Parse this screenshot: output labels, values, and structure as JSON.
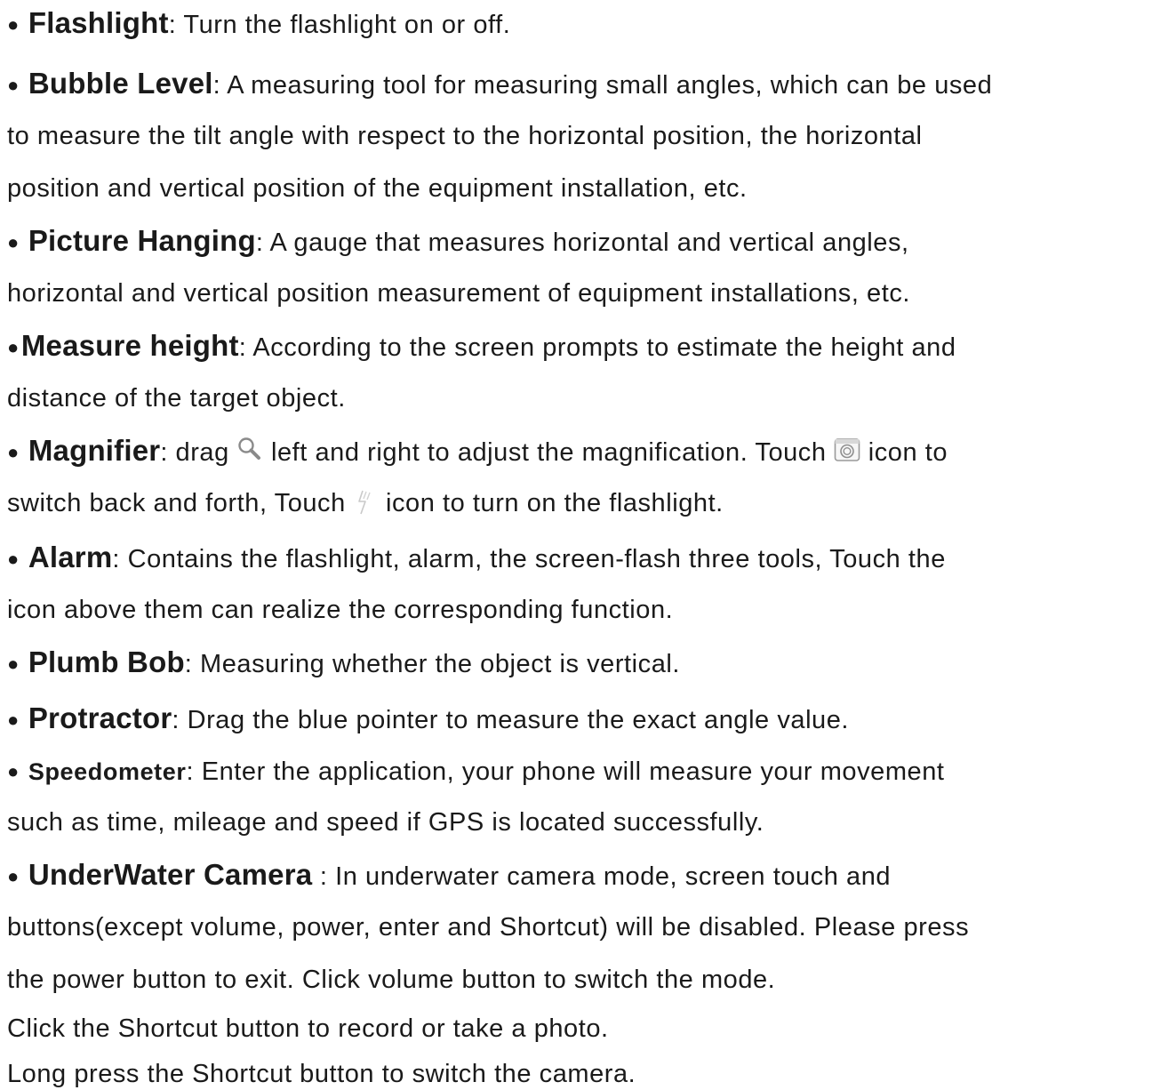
{
  "items": [
    {
      "term": "Flashlight",
      "sep": ": ",
      "text": "Turn the flashlight on or off."
    },
    {
      "term": "Bubble Level",
      "sep": ": ",
      "text": "A measuring tool for measuring small angles, which can be used",
      "cont": [
        "to measure the tilt angle with respect to the horizontal position, the horizontal",
        "position and vertical position of the equipment installation, etc."
      ]
    },
    {
      "term": "Picture Hanging",
      "sep": ": ",
      "text": "A gauge that measures horizontal and vertical angles,",
      "cont": [
        "horizontal and vertical position measurement of equipment installations, etc."
      ]
    },
    {
      "term": "Measure height",
      "sep": ": ",
      "text": "According to the screen prompts to estimate the height and",
      "cont": [
        "distance of the target object."
      ]
    },
    {
      "term": "Magnifier",
      "sep": ": ",
      "text_a": "drag",
      "text_b": "left and right to adjust the magnification. Touch",
      "text_c": "icon to",
      "cont_a": "switch back and forth, Touch",
      "cont_b": "icon to turn on the flashlight.",
      "icons": {
        "magnifier": "magnifier-icon",
        "camera": "camera-switch-icon",
        "flash": "flash-icon"
      }
    },
    {
      "term": "Alarm",
      "sep": ": ",
      "text": "Contains the flashlight, alarm, the screen-flash three tools, Touch the",
      "cont": [
        "icon above them can realize the corresponding function."
      ]
    },
    {
      "term": "Plumb Bob",
      "sep": ": ",
      "text": "Measuring whether the object is vertical."
    },
    {
      "term": "Protractor",
      "sep": ": ",
      "text": "Drag the blue pointer to measure the exact angle value."
    },
    {
      "term": "Speedometer",
      "sep": ": ",
      "text": "Enter the application, your phone will measure your movement",
      "cont": [
        "such as time, mileage and speed if GPS is located successfully."
      ]
    },
    {
      "term": "UnderWater Camera",
      "sep": " : ",
      "text": "In underwater camera mode, screen touch and",
      "cont": [
        "buttons(except volume, power, enter and Shortcut) will be disabled. Please press",
        "the power button to exit. Click volume button to switch the mode.",
        "Click the Shortcut button to record or take a photo.",
        "Long press the Shortcut button to switch the camera."
      ]
    }
  ],
  "bullet": "●"
}
